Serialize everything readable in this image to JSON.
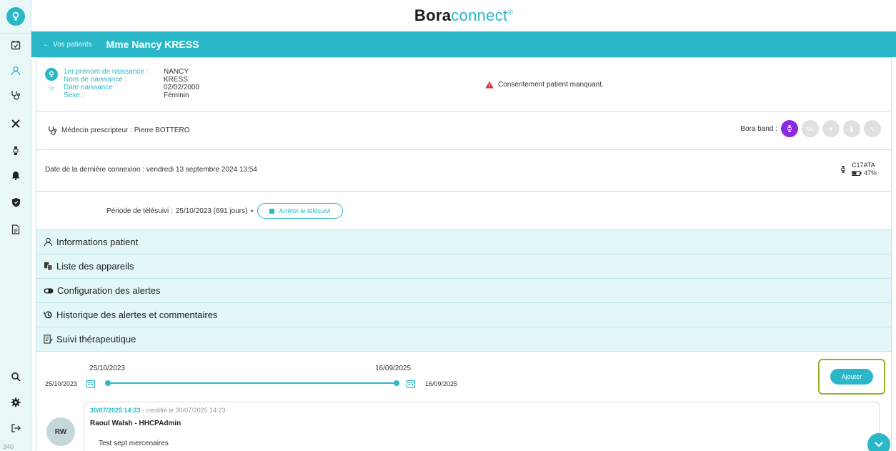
{
  "brand": {
    "name_bold": "Bora",
    "name_light": "connect",
    "mark": "®"
  },
  "sidebar": {
    "version": "340",
    "items": [
      {
        "icon": "calendar-check-icon"
      },
      {
        "icon": "user-icon",
        "active": true
      },
      {
        "icon": "stethoscope-icon"
      },
      {
        "icon": "tools-icon"
      },
      {
        "icon": "device-icon"
      },
      {
        "icon": "bell-icon"
      },
      {
        "icon": "shield-icon"
      },
      {
        "icon": "document-icon"
      }
    ],
    "bottom": [
      {
        "icon": "search-icon"
      },
      {
        "icon": "gear-icon"
      },
      {
        "icon": "logout-icon"
      }
    ]
  },
  "header": {
    "back_label": "Vos patients",
    "patient": "Mme Nancy KRESS"
  },
  "identity": {
    "rows": [
      {
        "label": "1er prénom de naissance :",
        "value": "NANCY"
      },
      {
        "label": "Nom de naissance :",
        "value": "KRESS"
      },
      {
        "label": "Date naissance :",
        "value": "02/02/2000"
      },
      {
        "label": "Sexe :",
        "value": "Féminin"
      }
    ],
    "consent_warning": "Consentement patient manquant."
  },
  "prescriber": {
    "text": "Médecin prescripteur : Pierre BOTTERO",
    "boraband_label": "Bora band :"
  },
  "connection": {
    "text": "Date de la dernière connexion : vendredi 13 septembre 2024 13:54",
    "device_id": "C17ATA",
    "battery": "47%"
  },
  "telesuivi": {
    "label": "Période de télésuivi :",
    "value": "25/10/2023 (691 jours)",
    "stop_button": "Arrêter le télésuivi"
  },
  "accordion": [
    {
      "icon": "user-outline-icon",
      "label": "Informations patient"
    },
    {
      "icon": "devices-icon",
      "label": "Liste des appareils"
    },
    {
      "icon": "toggle-icon",
      "label": "Configuration des alertes"
    },
    {
      "icon": "history-icon",
      "label": "Historique des alertes et commentaires"
    },
    {
      "icon": "notes-icon",
      "label": "Suivi thérapeutique"
    }
  ],
  "timeline": {
    "start_top": "25/10/2023",
    "end_top": "16/09/2025",
    "start_left": "25/10/2023",
    "end_right": "16/09/2025",
    "add_button": "Ajouter"
  },
  "comment": {
    "avatar": "RW",
    "datetime": "30/07/2025 14:23",
    "modified": " - modifié le 30/07/2025 14:23",
    "author": "Raoul Walsh - HHCPAdmin",
    "text": "Test sept mercenaires"
  }
}
